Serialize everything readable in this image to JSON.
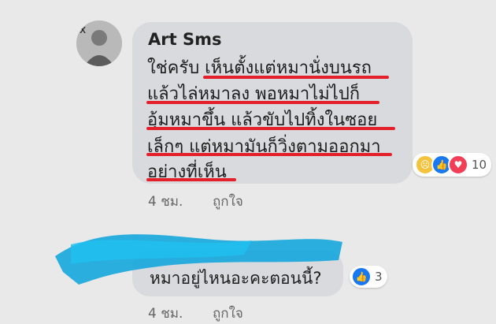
{
  "comment1": {
    "author": "Art Sms",
    "lines": [
      "ใช่ครับ เห็นตั้งแต่หมานั่งบนรถ",
      "แล้วไล่หมาลง พอหมาไม่ไปก็",
      "อุ้มหมาขึ้น แล้วขับไปทิ้งในซอย",
      "เล็กๆ แต่หมามันก็วิ่งตามออกมา",
      "อย่างที่เห็น"
    ],
    "time": "4 ชม.",
    "like_action": "ถูกใจ",
    "reaction_count": "10",
    "reaction_icons": [
      "sad-emoji",
      "like-thumb",
      "love-heart"
    ]
  },
  "comment2": {
    "text": "หมาอยู่ไหนอะคะตอนนี้?",
    "time": "4 ชม.",
    "like_action": "ถูกใจ",
    "reaction_count": "3",
    "reaction_icons": [
      "like-thumb"
    ]
  },
  "colors": {
    "underline": "#e4212b",
    "scribble": "#18a8dc",
    "like_blue": "#1877f2",
    "love_red": "#f33e58",
    "bubble": "#d9dadd"
  }
}
